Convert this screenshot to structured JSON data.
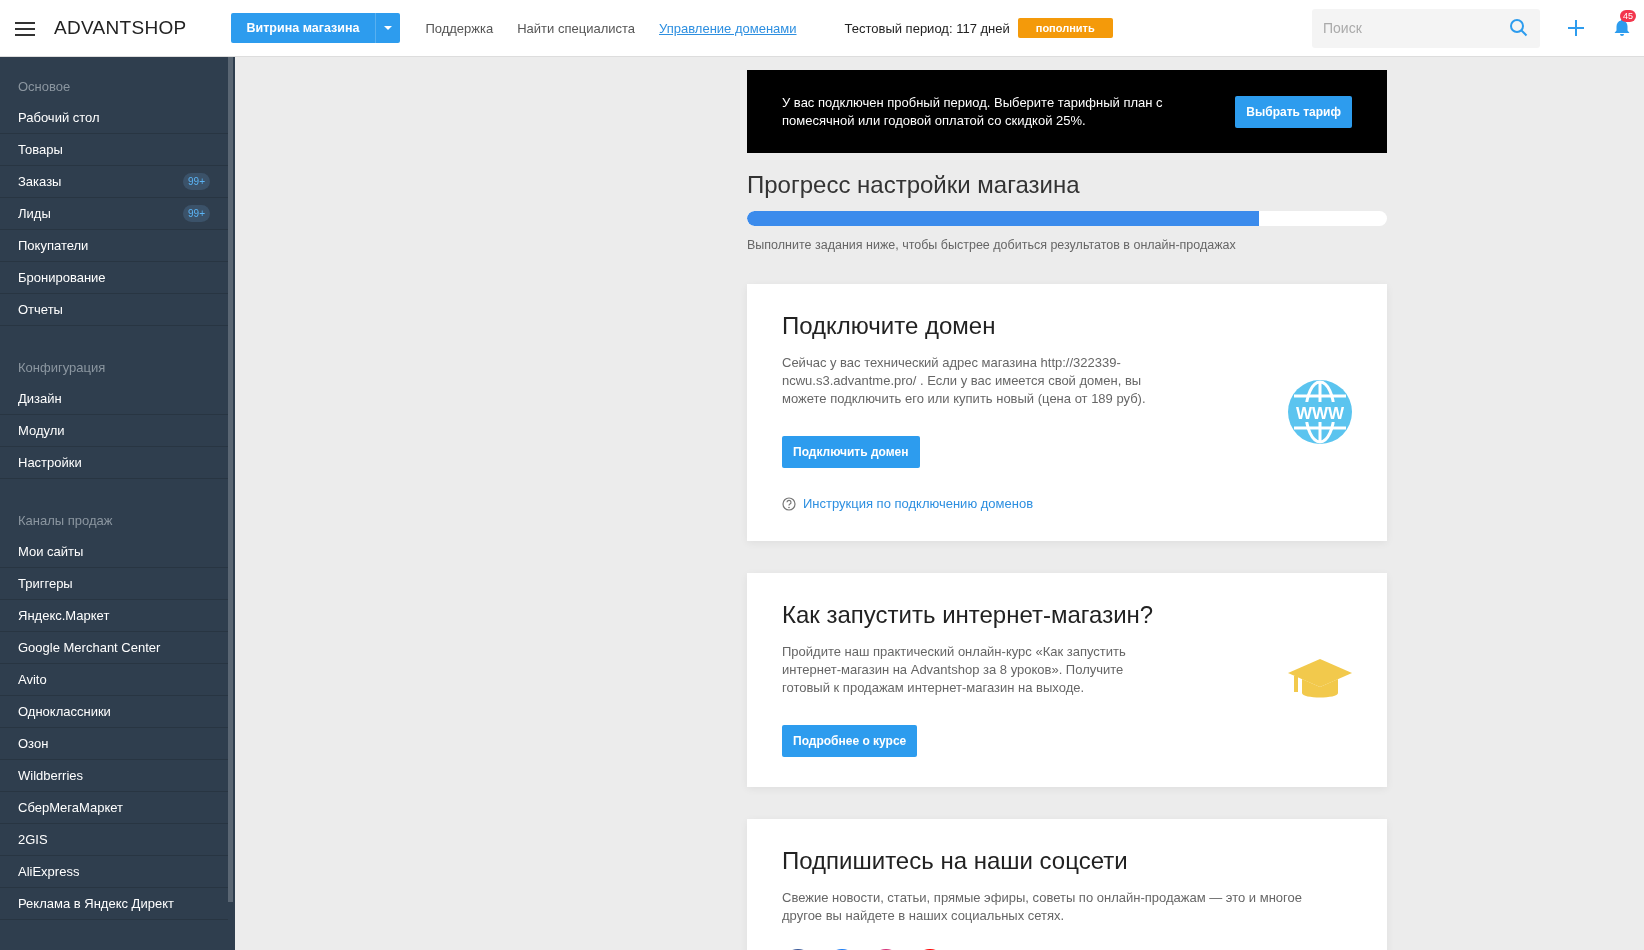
{
  "topbar": {
    "logo": "ADVANTSHOP",
    "storefront_button": "Витрина магазина",
    "links": [
      {
        "label": "Поддержка",
        "underlined": false
      },
      {
        "label": "Найти специалиста",
        "underlined": false
      },
      {
        "label": "Управление доменами",
        "underlined": true
      }
    ],
    "trial": {
      "text": "Тестовый период: 117 дней",
      "button": "пополнить"
    },
    "search": {
      "placeholder": "Поиск"
    },
    "notifications": {
      "count": "45"
    }
  },
  "sidebar": {
    "sections": [
      {
        "title": "Основое",
        "items": [
          {
            "label": "Рабочий стол"
          },
          {
            "label": "Товары"
          },
          {
            "label": "Заказы",
            "badge": "99+"
          },
          {
            "label": "Лиды",
            "badge": "99+"
          },
          {
            "label": "Покупатели"
          },
          {
            "label": "Бронирование"
          },
          {
            "label": "Отчеты"
          }
        ]
      },
      {
        "title": "Конфигурация",
        "items": [
          {
            "label": "Дизайн"
          },
          {
            "label": "Модули"
          },
          {
            "label": "Настройки"
          }
        ]
      },
      {
        "title": "Каналы продаж",
        "items": [
          {
            "label": "Мои сайты"
          },
          {
            "label": "Триггеры"
          },
          {
            "label": "Яндекс.Маркет"
          },
          {
            "label": "Google Merchant Center"
          },
          {
            "label": "Avito"
          },
          {
            "label": "Одноклассники"
          },
          {
            "label": "Озон"
          },
          {
            "label": "Wildberries"
          },
          {
            "label": "СберМегаМаркет"
          },
          {
            "label": "2GIS"
          },
          {
            "label": "AliExpress"
          },
          {
            "label": "Реклама в Яндекс Директ"
          }
        ]
      }
    ]
  },
  "banner": {
    "text": "У вас подключен пробный период. Выберите тарифный план с помесячной или годовой оплатой со скидкой 25%.",
    "button": "Выбрать тариф"
  },
  "progress": {
    "title": "Прогресс настройки магазина",
    "level": 0.8,
    "hint": "Выполните задания ниже, чтобы быстрее добиться результатов в онлайн-продажах"
  },
  "cards": [
    {
      "kind": "domain",
      "title": "Подключите домен",
      "text": "Сейчас у вас технический адрес магазина http://322339-ncwu.s3.advantme.pro/ . Если у вас имеется свой домен, вы можете подключить его или купить новый (цена от 189 руб).",
      "button": "Подключить домен",
      "link": "Инструкция по подключению доменов",
      "icon_text": "WWW"
    },
    {
      "kind": "course",
      "title": "Как запустить интернет-магазин?",
      "text": "Пройдите наш практический онлайн-курс «Как запустить интернет-магазин на Advantshop за 8 уроков». Получите готовый к продажам интернет-магазин на выходе.",
      "button": "Подробнее о курсе"
    },
    {
      "kind": "social",
      "title": "Подпишитесь на наши соцсети",
      "text": "Свежие новости, статьи, прямые эфиры, советы по онлайн-продажам — это и многое другое вы найдете в наших социальных сетях."
    }
  ]
}
